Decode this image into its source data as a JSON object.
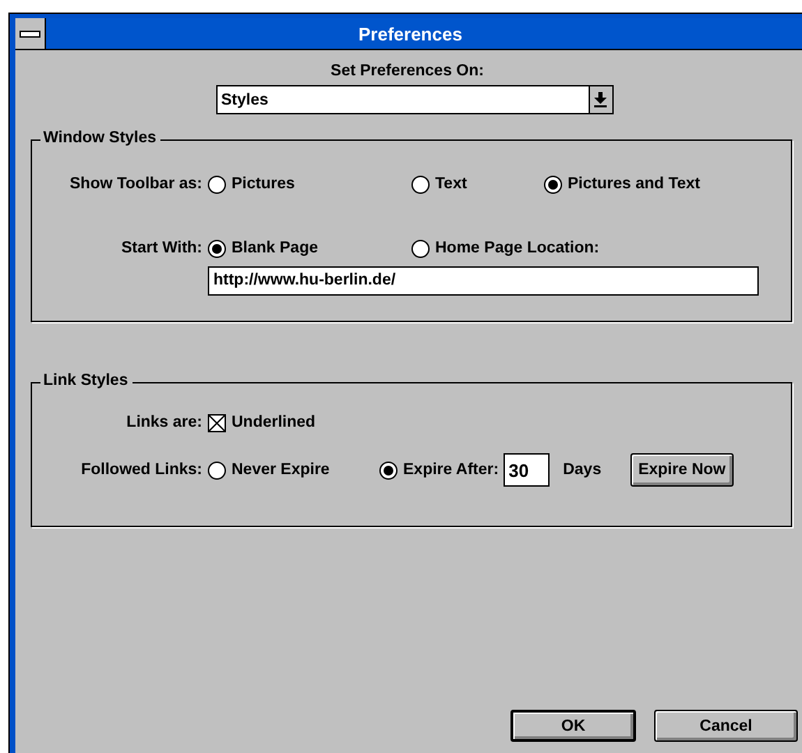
{
  "window": {
    "title": "Preferences"
  },
  "preferences_on": {
    "label": "Set Preferences On:",
    "value": "Styles"
  },
  "window_styles": {
    "title": "Window Styles",
    "toolbar": {
      "label": "Show Toolbar as:",
      "options": [
        {
          "label": "Pictures",
          "selected": false
        },
        {
          "label": "Text",
          "selected": false
        },
        {
          "label": "Pictures and Text",
          "selected": true
        }
      ]
    },
    "start_with": {
      "label": "Start With:",
      "options": [
        {
          "label": "Blank Page",
          "selected": true
        },
        {
          "label": "Home Page Location:",
          "selected": false
        }
      ]
    },
    "home_page": {
      "value": "http://www.hu-berlin.de/"
    }
  },
  "link_styles": {
    "title": "Link Styles",
    "links_are": {
      "label": "Links are:",
      "checkbox": {
        "label": "Underlined",
        "checked": true
      }
    },
    "followed": {
      "label": "Followed Links:",
      "options": [
        {
          "label": "Never Expire",
          "selected": false
        },
        {
          "label": "Expire After:",
          "selected": true
        }
      ],
      "days": "30",
      "days_unit": "Days",
      "button": "Expire Now"
    }
  },
  "buttons": [
    {
      "label": "OK",
      "default": true
    },
    {
      "label": "Cancel",
      "default": false
    }
  ]
}
